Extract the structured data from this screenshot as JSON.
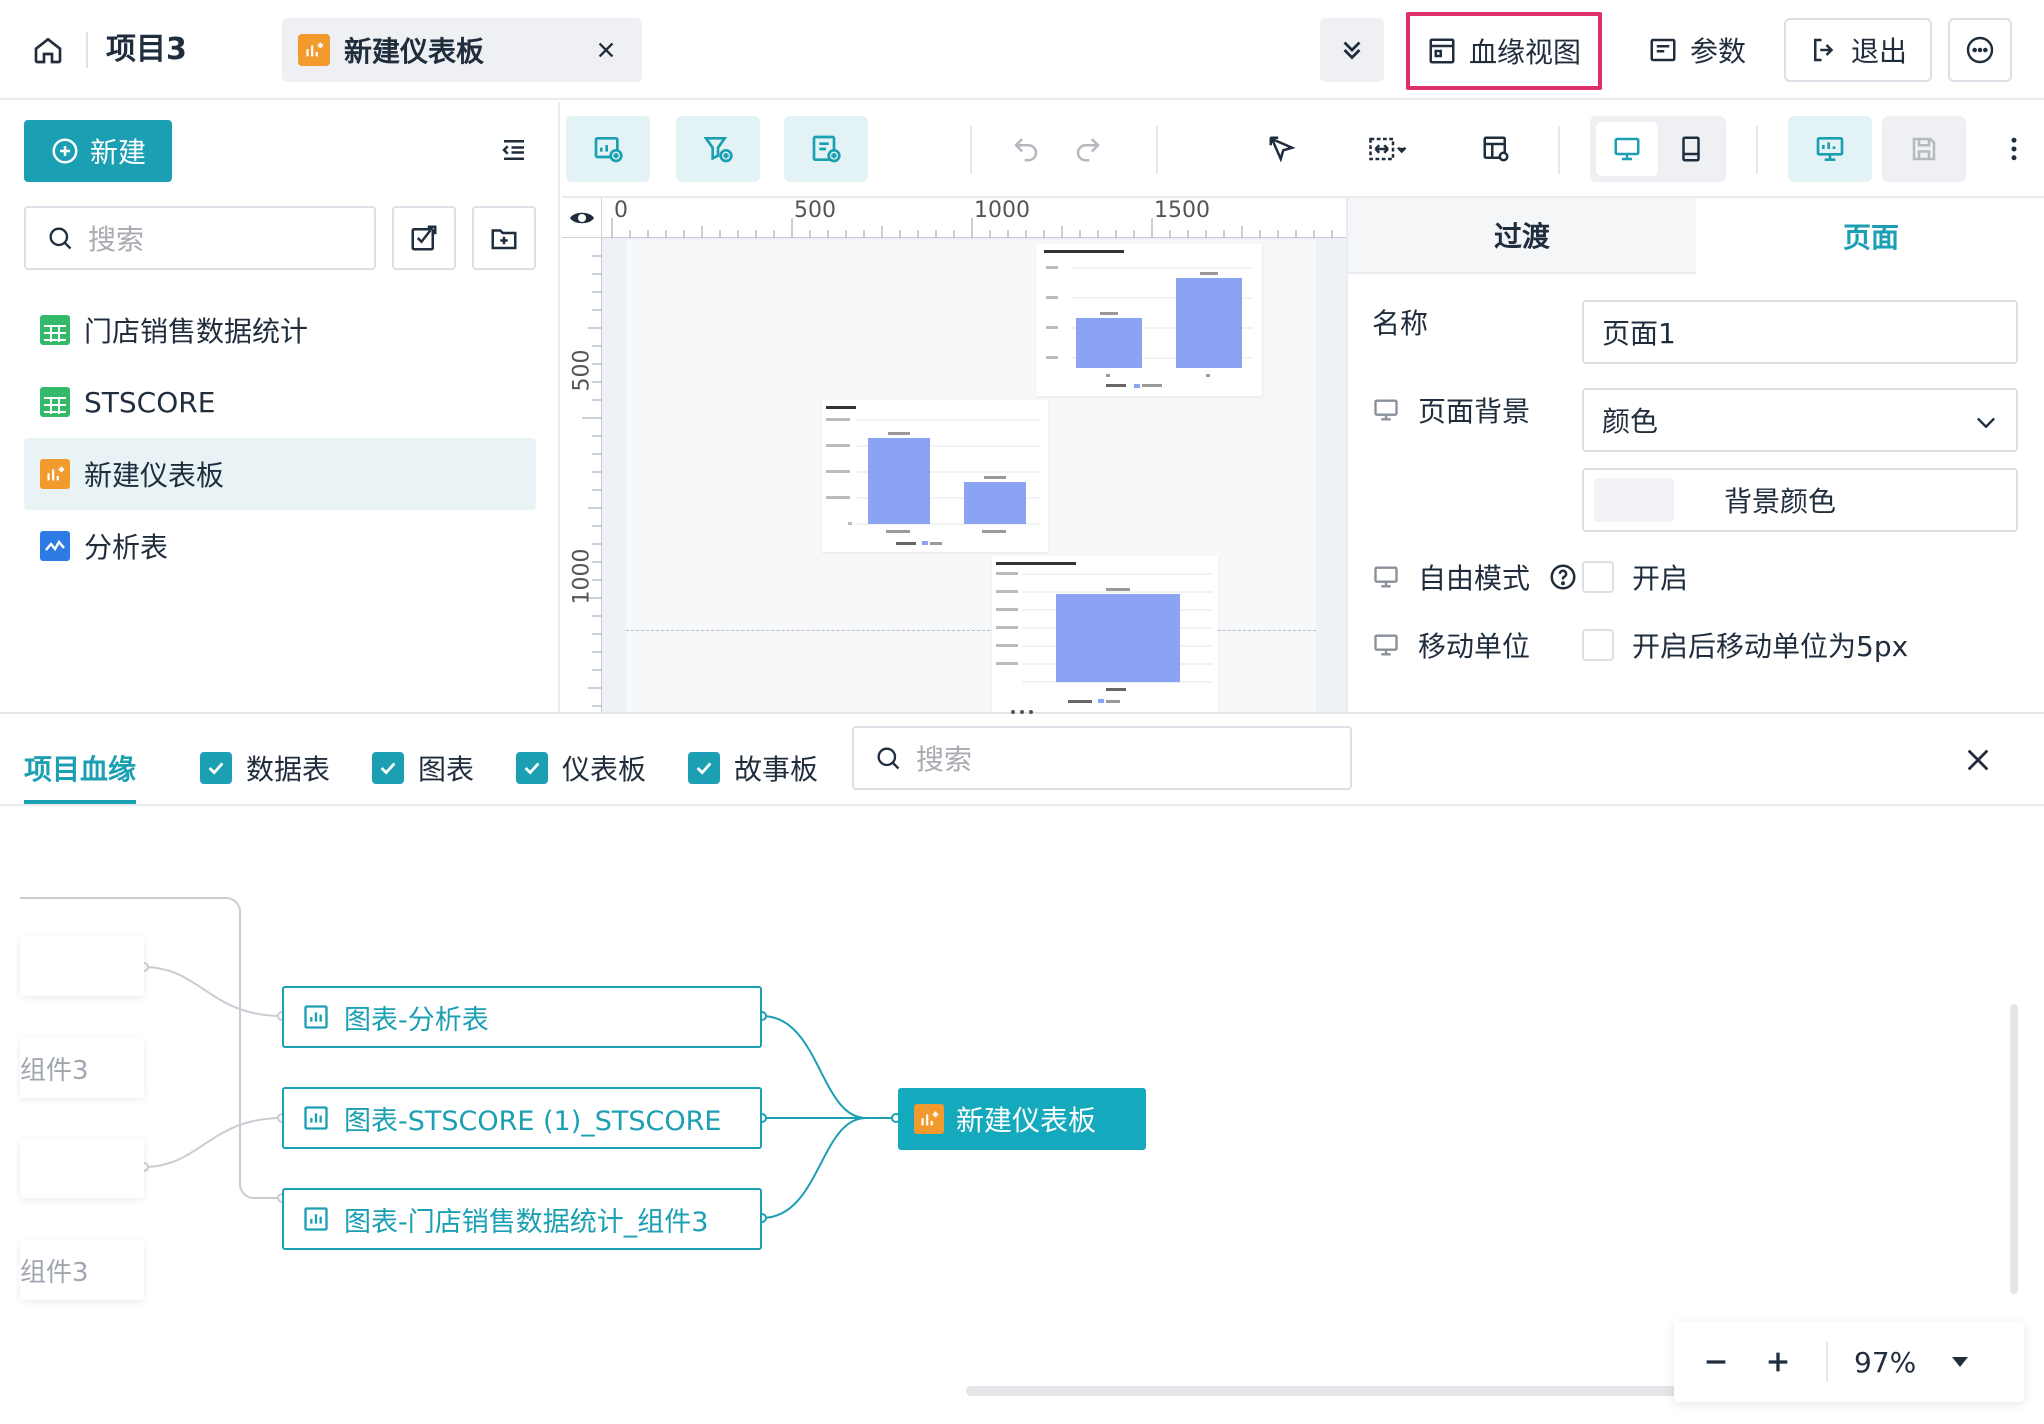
{
  "header": {
    "project_title": "项目3",
    "tab_title": "新建仪表板",
    "lineage_view": "血缘视图",
    "params": "参数",
    "exit": "退出"
  },
  "sidebar": {
    "new_button": "新建",
    "search_placeholder": "搜索",
    "items": [
      {
        "label": "门店销售数据统计",
        "icon": "table-icon"
      },
      {
        "label": "STSCORE",
        "icon": "table-icon"
      },
      {
        "label": "新建仪表板",
        "icon": "dashboard-icon"
      },
      {
        "label": "分析表",
        "icon": "analysis-icon"
      }
    ]
  },
  "ruler": {
    "h_ticks": [
      "0",
      "500",
      "1000",
      "1500"
    ],
    "v_ticks": [
      "500",
      "1000"
    ]
  },
  "right_panel": {
    "tabs": [
      "过渡",
      "页面"
    ],
    "active_tab": "页面",
    "name_label": "名称",
    "name_value": "页面1",
    "bg_label": "页面背景",
    "bg_value": "颜色",
    "bg_color_label": "背景颜色",
    "free_mode_label": "自由模式",
    "free_mode_option": "开启",
    "move_unit_label": "移动单位",
    "move_unit_option": "开启后移动单位为5px"
  },
  "lineage": {
    "title": "项目血缘",
    "filters": [
      "数据表",
      "图表",
      "仪表板",
      "故事板"
    ],
    "search_placeholder": "搜索",
    "ghost_labels": [
      "组件3",
      "组件3"
    ],
    "nodes": [
      "图表-分析表",
      "图表-STSCORE (1)_STSCORE",
      "图表-门店销售数据统计_组件3"
    ],
    "target": "新建仪表板",
    "zoom": "97%"
  },
  "colors": {
    "accent": "#1b9fb3",
    "highlight_border": "#e0306a",
    "dashboard_icon": "#f29a2e",
    "table_icon": "#34b96a",
    "chart_bar": "#8aa3f2"
  }
}
